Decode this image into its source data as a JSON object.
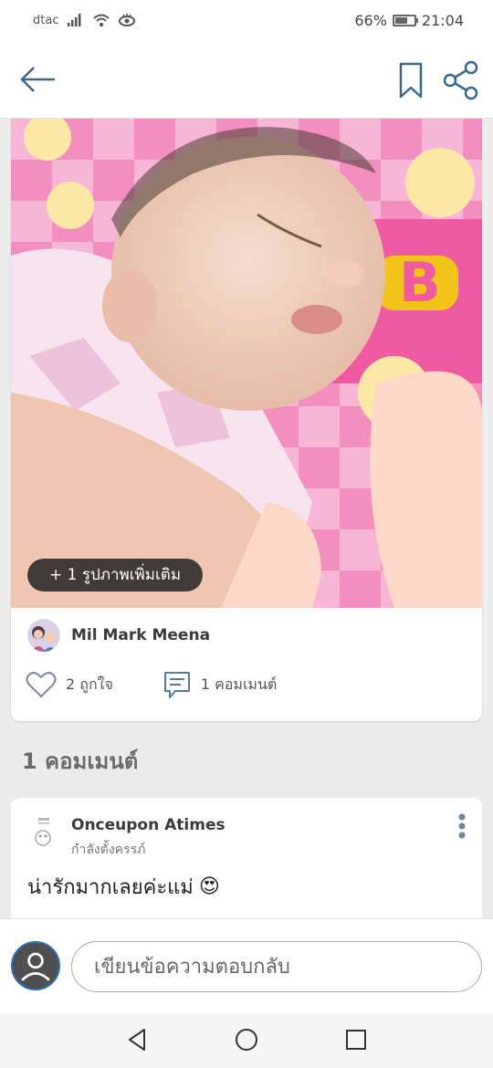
{
  "status_bar": {
    "carrier": "dtac",
    "battery": "66%",
    "battery_level": 0.66,
    "time": "21:04"
  },
  "icons": {
    "signal": "signal-icon",
    "wifi": "wifi-icon",
    "eye": "eye-comfort-icon",
    "battery": "battery-icon",
    "back": "arrow-left-icon",
    "bookmark": "bookmark-icon",
    "share": "share-icon",
    "heart": "heart-icon",
    "comment": "comment-icon",
    "more": "more-vertical-icon",
    "nav_back": "triangle-back-icon",
    "nav_home": "circle-home-icon",
    "nav_recent": "square-recent-icon"
  },
  "post": {
    "more_photos_label": "+ 1 รูปภาพเพิ่มเติม",
    "author_name": "Mil Mark Meena",
    "likes_label": "2 ถูกใจ",
    "comments_label": "1 คอมเมนต์"
  },
  "comments_section": {
    "header": "1 คอมเมนต์",
    "items": [
      {
        "name": "Onceupon Atimes",
        "status": "กำลังตั้งครรภ์",
        "text": "น่ารักมากเลยค่ะแม่",
        "emoji": "😍"
      }
    ]
  },
  "reply": {
    "placeholder": "เขียนข้อความตอบกลับ"
  },
  "colors": {
    "accent": "#2f6fb5",
    "background": "#ececec",
    "pill_bg": "#282828"
  }
}
